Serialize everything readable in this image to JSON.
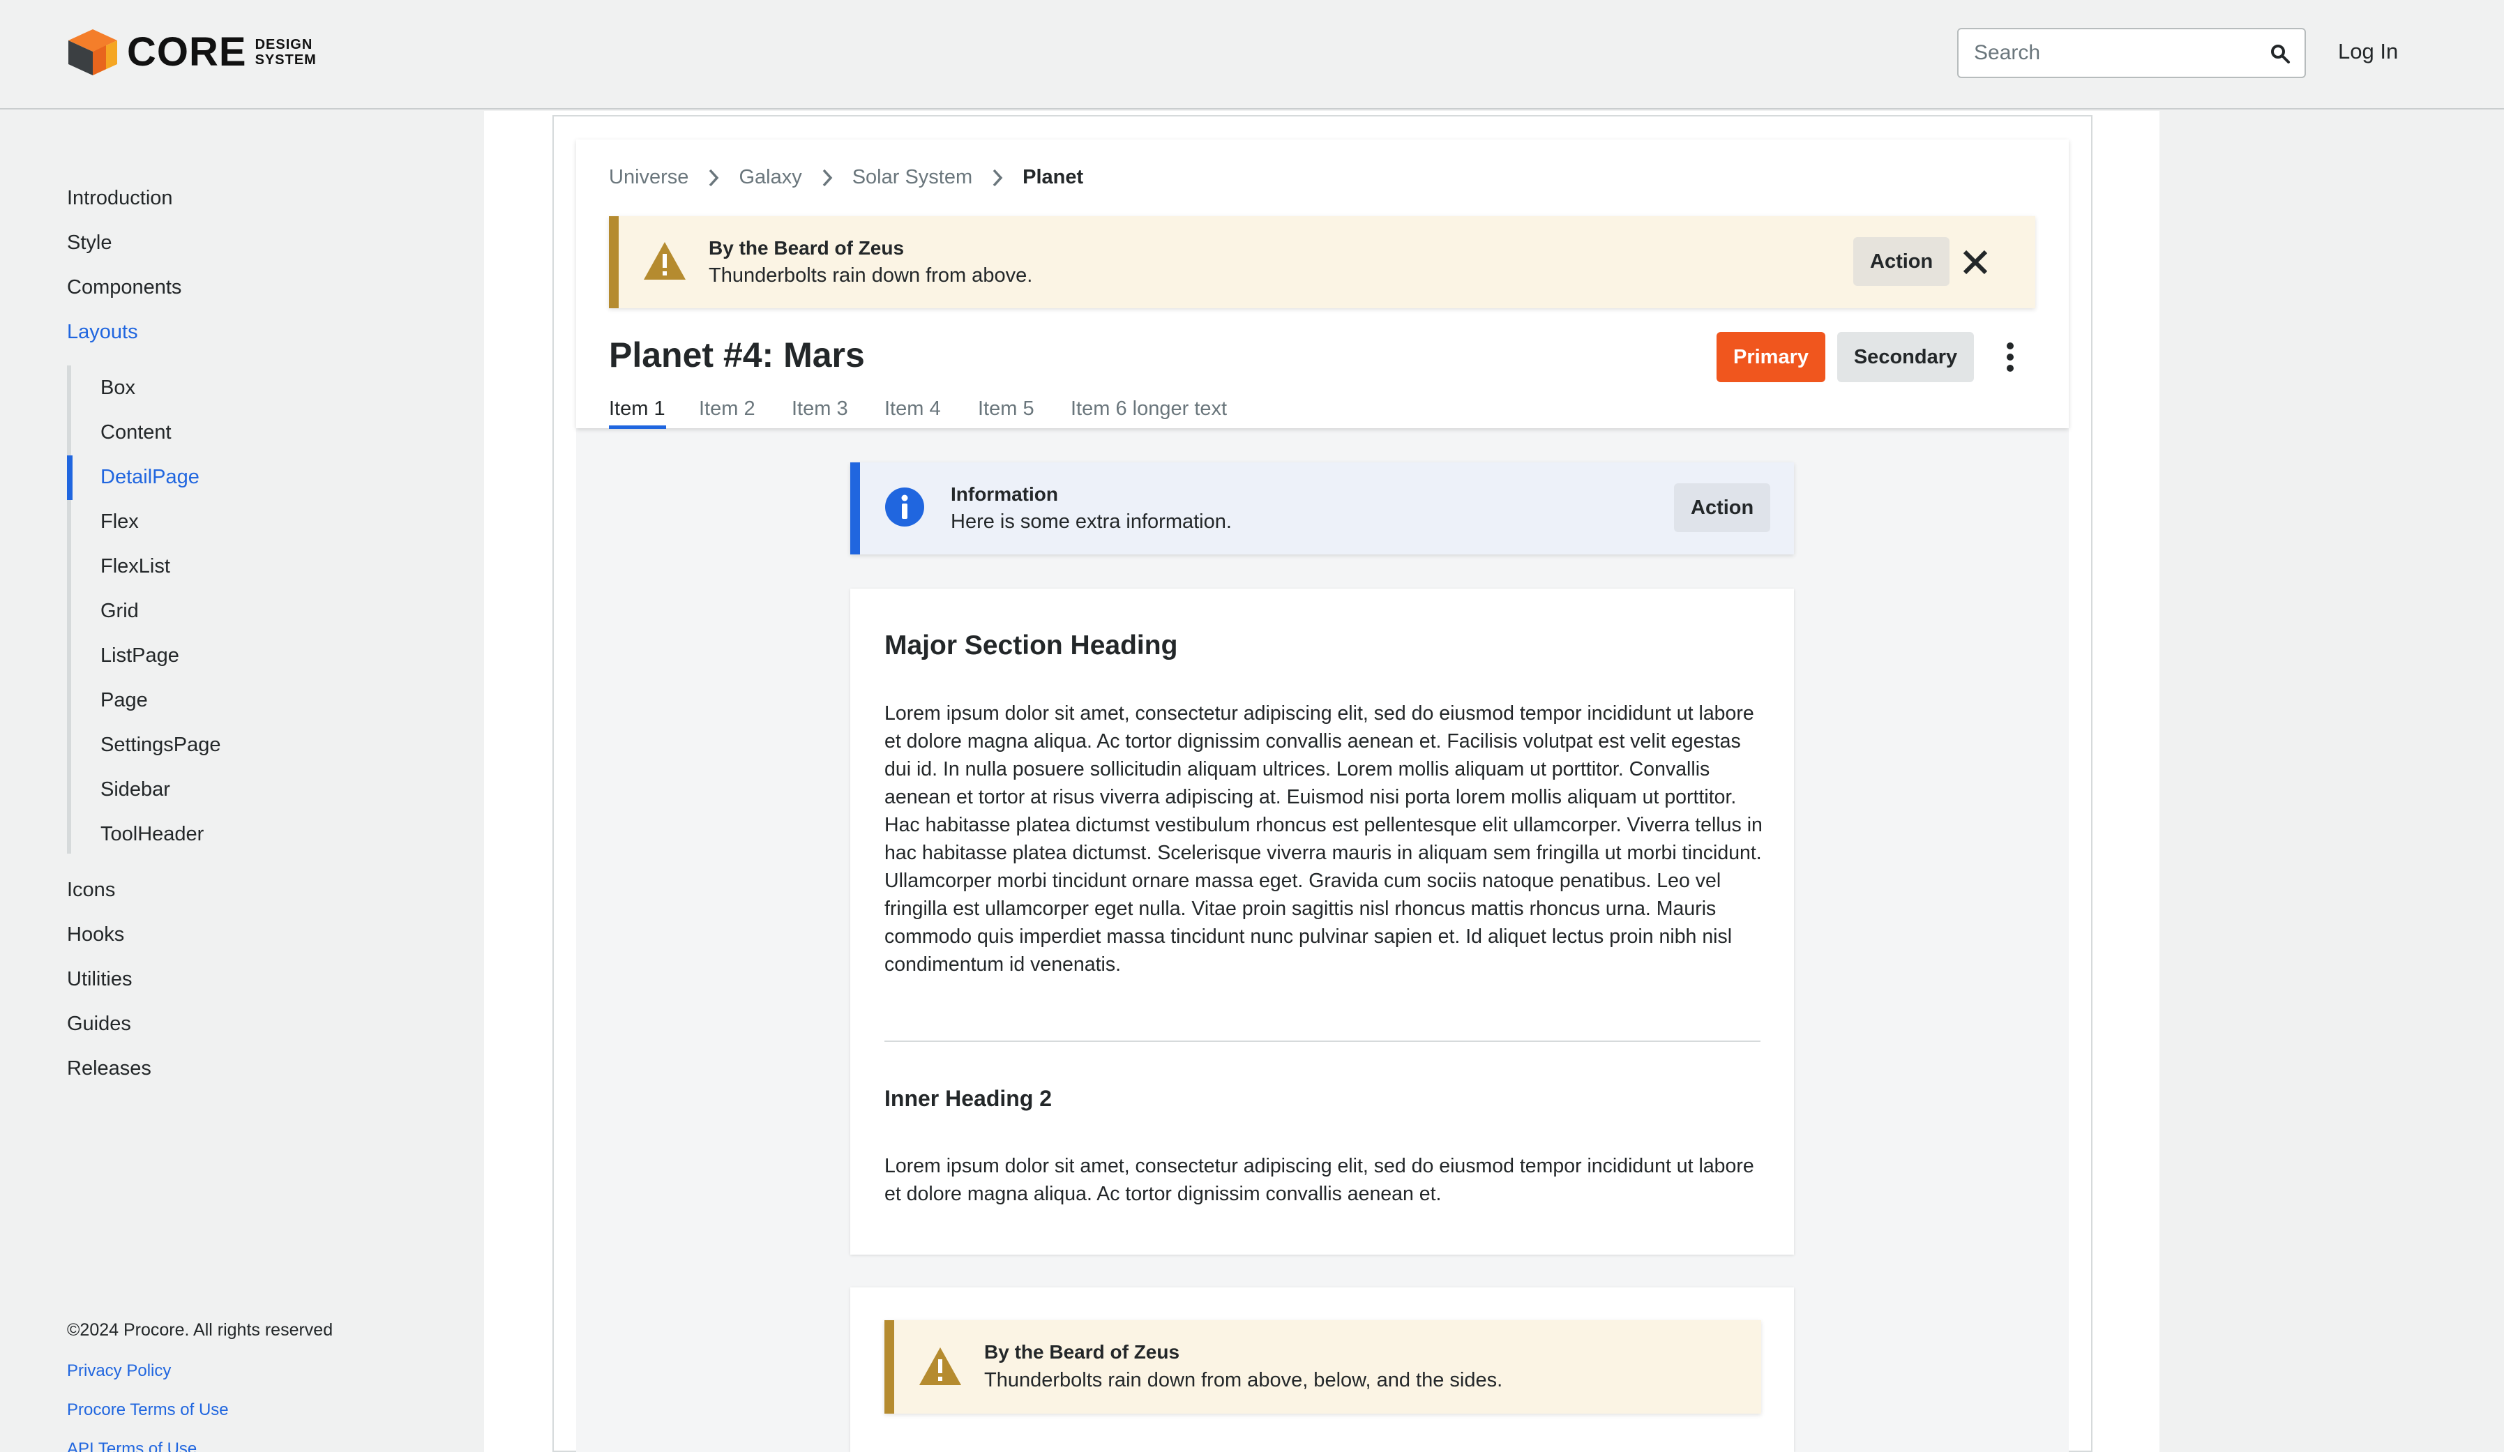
{
  "header": {
    "logo_text": "CORE",
    "logo_sub_line1": "DESIGN",
    "logo_sub_line2": "SYSTEM",
    "search_placeholder": "Search",
    "login_label": "Log In"
  },
  "sidebar": {
    "items_top": [
      {
        "label": "Introduction"
      },
      {
        "label": "Style"
      },
      {
        "label": "Components"
      },
      {
        "label": "Layouts",
        "active": true
      }
    ],
    "sub_items": [
      {
        "label": "Box"
      },
      {
        "label": "Content"
      },
      {
        "label": "DetailPage",
        "active": true
      },
      {
        "label": "Flex"
      },
      {
        "label": "FlexList"
      },
      {
        "label": "Grid"
      },
      {
        "label": "ListPage"
      },
      {
        "label": "Page"
      },
      {
        "label": "SettingsPage"
      },
      {
        "label": "Sidebar"
      },
      {
        "label": "ToolHeader"
      }
    ],
    "items_bottom": [
      {
        "label": "Icons"
      },
      {
        "label": "Hooks"
      },
      {
        "label": "Utilities"
      },
      {
        "label": "Guides"
      },
      {
        "label": "Releases"
      }
    ],
    "footer": {
      "copyright": "©2024 Procore. All rights reserved",
      "links": [
        "Privacy Policy",
        "Procore Terms of Use",
        "API Terms of Use"
      ]
    }
  },
  "breadcrumb": [
    "Universe",
    "Galaxy",
    "Solar System",
    "Planet"
  ],
  "header_banner": {
    "title": "By the Beard of Zeus",
    "text": "Thunderbolts rain down from above.",
    "action_label": "Action"
  },
  "page": {
    "title": "Planet #4: Mars",
    "primary_label": "Primary",
    "secondary_label": "Secondary",
    "tabs": [
      "Item 1",
      "Item 2",
      "Item 3",
      "Item 4",
      "Item 5",
      "Item 6 longer text"
    ],
    "active_tab": "Item 1"
  },
  "info_banner": {
    "title": "Information",
    "text": "Here is some extra information.",
    "action_label": "Action"
  },
  "section": {
    "heading": "Major Section Heading",
    "paragraph": "Lorem ipsum dolor sit amet, consectetur adipiscing elit, sed do eiusmod tempor incididunt ut labore et dolore magna aliqua. Ac tortor dignissim convallis aenean et. Facilisis volutpat est velit egestas dui id. In nulla posuere sollicitudin aliquam ultrices. Lorem mollis aliquam ut porttitor. Convallis aenean et tortor at risus viverra adipiscing at. Euismod nisi porta lorem mollis aliquam ut porttitor. Hac habitasse platea dictumst vestibulum rhoncus est pellentesque elit ullamcorper. Viverra tellus in hac habitasse platea dictumst. Scelerisque viverra mauris in aliquam sem fringilla ut morbi tincidunt. Ullamcorper morbi tincidunt ornare massa eget. Gravida cum sociis natoque penatibus. Leo vel fringilla est ullamcorper eget nulla. Vitae proin sagittis nisl rhoncus mattis rhoncus urna. Mauris commodo quis imperdiet massa tincidunt nunc pulvinar sapien et. Id aliquet lectus proin nibh nisl condimentum id venenatis.",
    "inner_heading": "Inner Heading 2",
    "inner_paragraph": "Lorem ipsum dolor sit amet, consectetur adipiscing elit, sed do eiusmod tempor incididunt ut labore et dolore magna aliqua. Ac tortor dignissim convallis aenean et."
  },
  "second_card_banner": {
    "title": "By the Beard of Zeus",
    "text": "Thunderbolts rain down from above, below, and the sides."
  },
  "colors": {
    "accent_blue": "#2066df",
    "primary_orange": "#f0561e",
    "warning_gold": "#b58b2f",
    "warning_bg": "#fbf4e4",
    "info_bg": "#edf1f9"
  }
}
